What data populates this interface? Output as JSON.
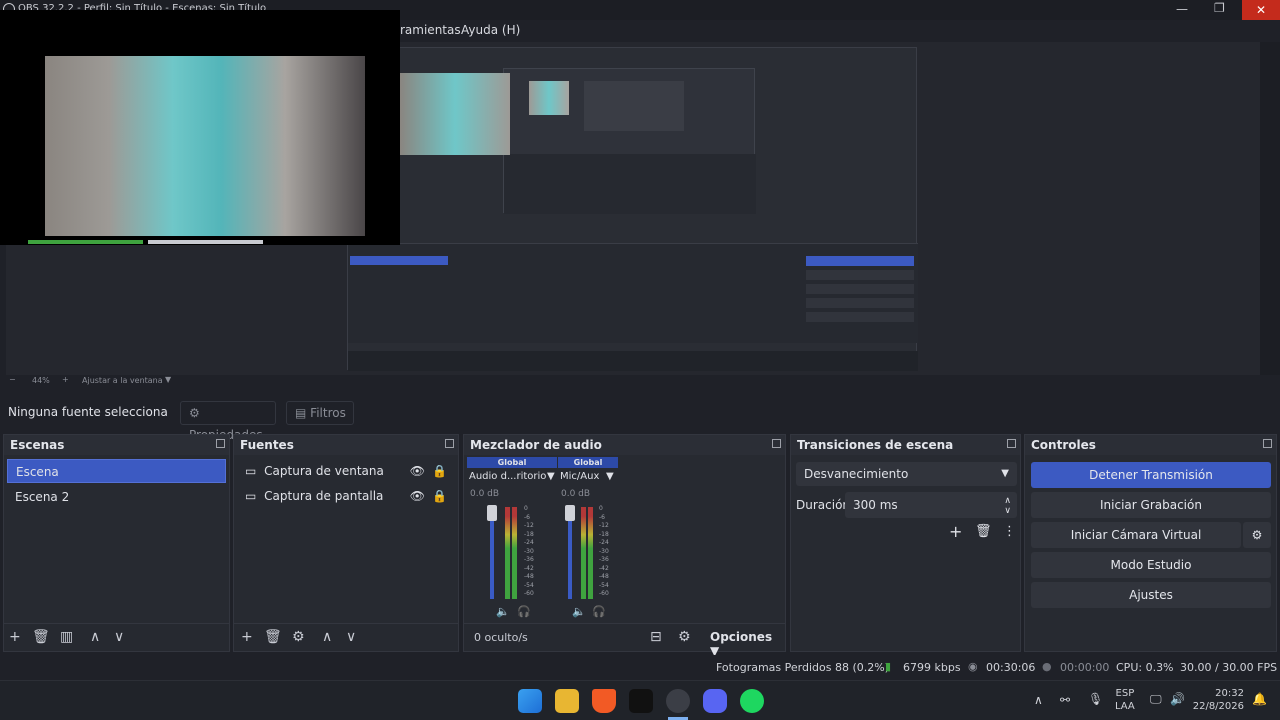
{
  "window": {
    "title": "OBS 32.2.2 - Perfil: Sin Título - Escenas: Sin Título"
  },
  "menu": {
    "items": [
      "ramientas",
      "Ayuda (H)"
    ]
  },
  "zoom": {
    "minus": "−",
    "level": "44%",
    "plus": "+",
    "fit": "Ajustar a la ventana"
  },
  "source_bar": {
    "status": "Ninguna fuente selecciona",
    "properties": "Propiedades",
    "filters": "Filtros"
  },
  "scenes": {
    "title": "Escenas",
    "items": [
      "Escena",
      "Escena 2"
    ],
    "selected": 0
  },
  "sources": {
    "title": "Fuentes",
    "items": [
      "Captura de ventana",
      "Captura de pantalla"
    ]
  },
  "mixer": {
    "title": "Mezclador de audio",
    "channels": [
      {
        "badge": "Global",
        "name": "Audio d...ritorio",
        "db": "0.0 dB"
      },
      {
        "badge": "Global",
        "name": "Mic/Aux",
        "db": "0.0 dB"
      }
    ],
    "scale": [
      "0",
      "-6",
      "-12",
      "-18",
      "-24",
      "-30",
      "-36",
      "-42",
      "-48",
      "-54",
      "-60"
    ],
    "hidden": "0 oculto/s",
    "options": "Opciones"
  },
  "transitions": {
    "title": "Transiciones de escena",
    "selected": "Desvanecimiento",
    "duration_label": "Duración",
    "duration_value": "300 ms"
  },
  "controls": {
    "title": "Controles",
    "stop_stream": "Detener Transmisión",
    "start_record": "Iniciar Grabación",
    "start_vcam": "Iniciar Cámara Virtual",
    "studio_mode": "Modo Estudio",
    "settings": "Ajustes"
  },
  "status": {
    "dropped": "Fotogramas Perdidos 88 (0.2%)",
    "bitrate": "6799 kbps",
    "stream_time": "00:30:06",
    "rec_time": "00:00:00",
    "cpu": "CPU: 0.3%",
    "fps": "30.00 / 30.00 FPS"
  },
  "taskbar": {
    "lang": "ESP",
    "layout": "LAA",
    "time": "20:32",
    "date": "22/8/2026"
  },
  "colors": {
    "accent": "#3c5ac2",
    "bg": "#1f2128",
    "panel": "#272a31"
  }
}
